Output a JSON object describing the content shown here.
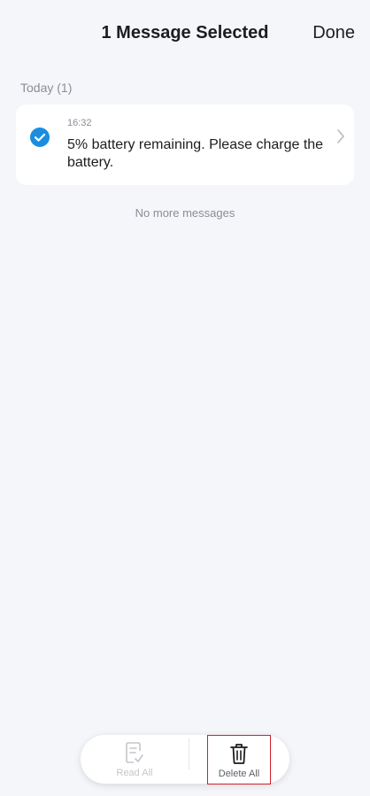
{
  "header": {
    "title": "1 Message Selected",
    "done_label": "Done"
  },
  "section": {
    "label": "Today (1)"
  },
  "messages": [
    {
      "time": "16:32",
      "text": "5% battery remaining. Please charge the battery.",
      "selected": true
    }
  ],
  "footer_note": "No more messages",
  "bottom_bar": {
    "read_all_label": "Read All",
    "delete_all_label": "Delete All",
    "read_all_enabled": false
  },
  "colors": {
    "accent": "#1a8de0",
    "background": "#f5f6fa",
    "highlight_border": "#d2202a"
  },
  "icons": {
    "check": "check-circle-icon",
    "chevron": "chevron-right-icon",
    "read_all": "document-check-icon",
    "delete_all": "trash-icon"
  }
}
